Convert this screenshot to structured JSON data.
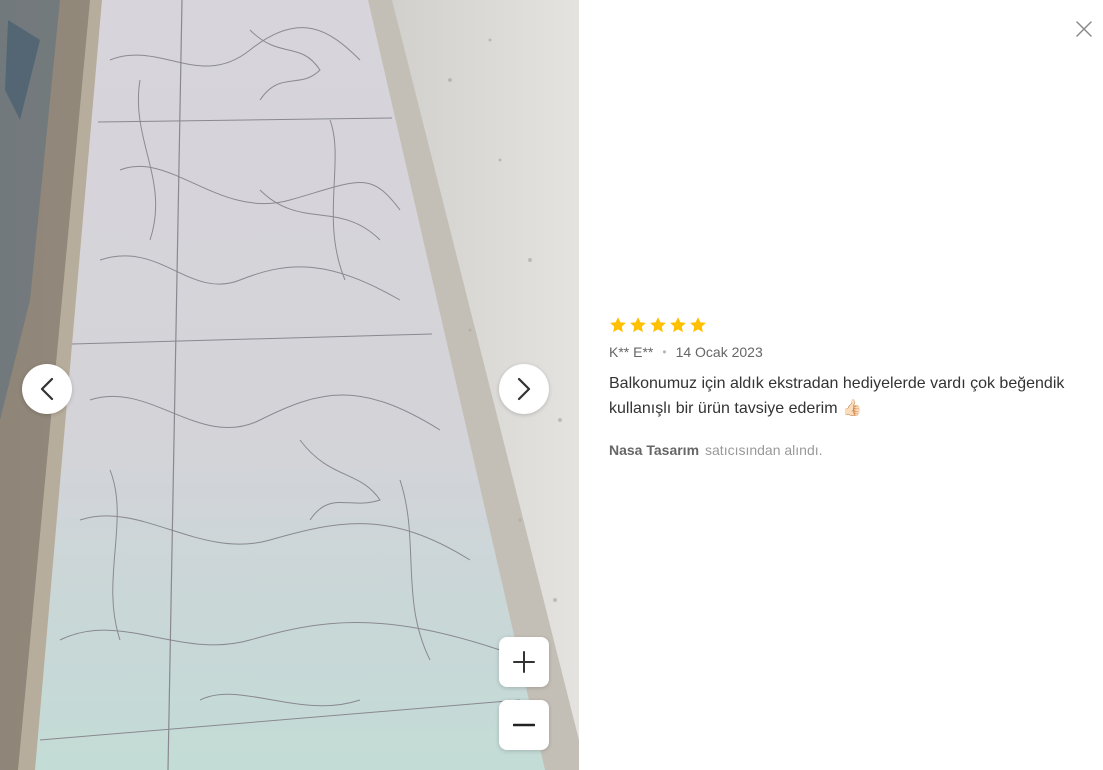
{
  "review": {
    "rating": 5,
    "rating_max": 5,
    "star_color": "#FFC000",
    "author": "K** E**",
    "separator": "•",
    "date": "14 Ocak 2023",
    "text": "Balkonumuz için aldık ekstradan hediyelerde vardı çok beğendik kullanışlı bir ürün tavsiye ederim",
    "emoji": "👍🏻"
  },
  "seller": {
    "name": "Nasa Tasarım",
    "suffix": "satıcısından alındı."
  },
  "photo": {
    "description_icon": "review-photo"
  },
  "icons": {
    "close": "close-icon",
    "prev": "chevron-left-icon",
    "next": "chevron-right-icon",
    "zoom_in": "plus-icon",
    "zoom_out": "minus-icon"
  }
}
